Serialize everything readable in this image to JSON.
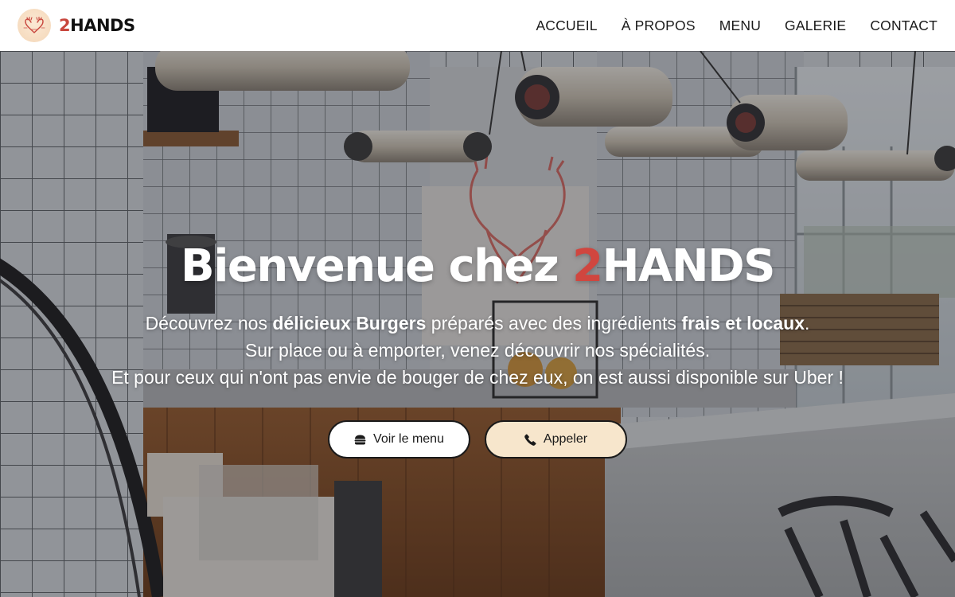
{
  "brand": {
    "name_number": "2",
    "name_rest": "HANDS",
    "logo_icon": "hands-heart-logo-icon",
    "accent_color": "#c8463d"
  },
  "nav": {
    "items": [
      {
        "label": "ACCUEIL"
      },
      {
        "label": "À PROPOS"
      },
      {
        "label": "MENU"
      },
      {
        "label": "GALERIE"
      },
      {
        "label": "CONTACT"
      }
    ]
  },
  "hero": {
    "title_prefix": "Bienvenue chez ",
    "title_number": "2",
    "title_rest": "HANDS",
    "line1_part1": "Découvrez nos ",
    "line1_bold1": "délicieux Burgers",
    "line1_part2": " préparés avec des ingrédients ",
    "line1_bold2": "frais et locaux",
    "line1_part3": ".",
    "line2": "Sur place ou à emporter, venez découvrir nos spécialités.",
    "line3": "Et pour ceux qui n'ont pas envie de bouger de chez eux, on est aussi disponible sur Uber !",
    "background": "restaurant-interior-photo"
  },
  "buttons": {
    "menu_label": "Voir le menu",
    "menu_icon": "burger-icon",
    "call_label": "Appeler",
    "call_icon": "phone-icon",
    "call_color": "#f7e6cc"
  }
}
